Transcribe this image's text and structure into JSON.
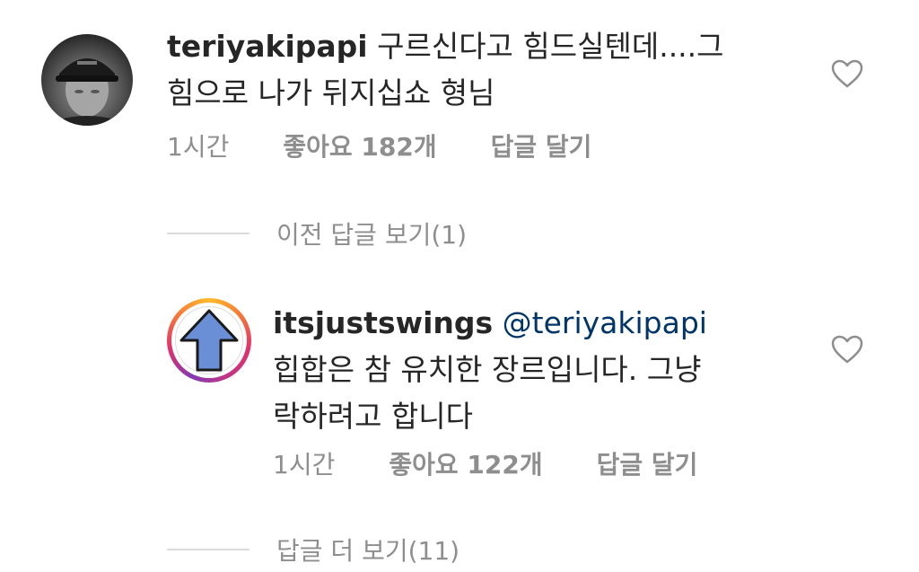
{
  "comment": {
    "username": "teriyakipapi",
    "text_line1": "구르신다고 힘드실텐데....그",
    "text_line2": "힘으로 나가 뒤지십쇼 형님",
    "time": "1시간",
    "likes": "좋아요 182개",
    "reply": "답글 달기",
    "like_icon": "heart-outline-icon"
  },
  "previous_replies": {
    "label": "이전 답글 보기(1)"
  },
  "reply": {
    "username": "itsjustswings",
    "mention": "@teriyakipapi",
    "text_line1": "힙합은 참 유치한 장르입니다. 그냥",
    "text_line2": "락하려고 합니다",
    "time": "1시간",
    "likes": "좋아요 122개",
    "reply": "답글 달기",
    "like_icon": "heart-outline-icon",
    "story_ring_colors": [
      "#fdbb2d",
      "#f77737",
      "#e1306c",
      "#833ab4"
    ],
    "avatar_arrow_color": "#6b8fd6"
  },
  "more_replies": {
    "label": "답글 더 보기(11)"
  }
}
